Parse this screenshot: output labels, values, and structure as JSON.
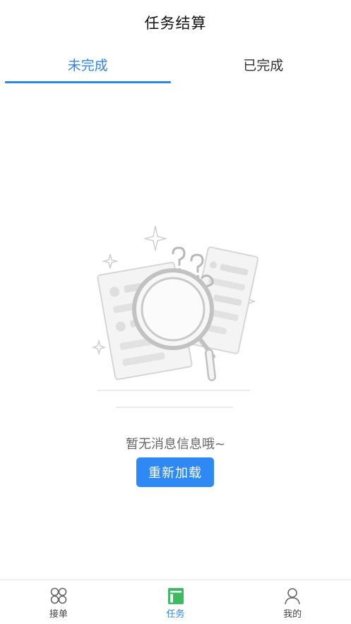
{
  "header": {
    "title": "任务结算"
  },
  "tabs": [
    {
      "label": "未完成",
      "active": true
    },
    {
      "label": "已完成",
      "active": false
    }
  ],
  "empty_state": {
    "message": "暂无消息信息哦~",
    "reload_label": "重新加载",
    "illustration_icon": "magnifier-question-icon"
  },
  "bottom_nav": [
    {
      "label": "接单",
      "icon": "grid-circles-icon",
      "active": false
    },
    {
      "label": "任务",
      "icon": "task-board-icon",
      "active": true
    },
    {
      "label": "我的",
      "icon": "user-icon",
      "active": false
    }
  ],
  "colors": {
    "accent": "#2e86e6",
    "button": "#2f89f5",
    "nav_active_icon": "#3dbb63"
  }
}
